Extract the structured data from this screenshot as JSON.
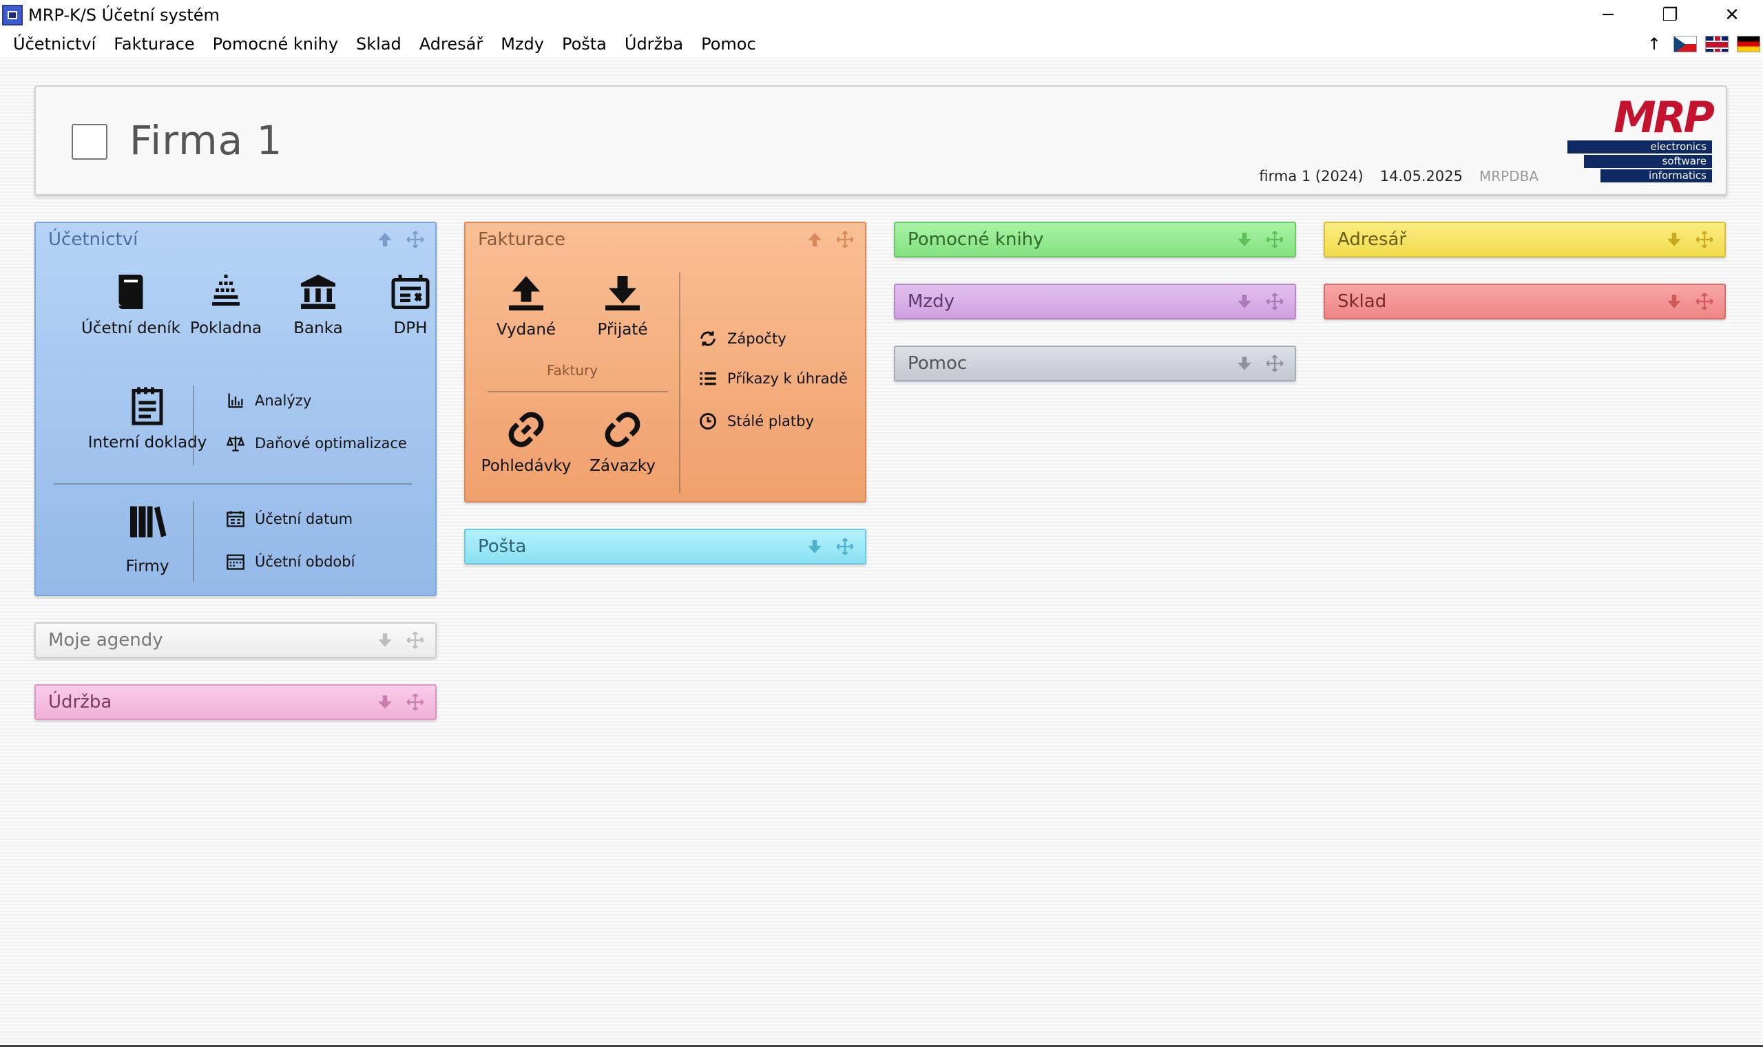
{
  "window": {
    "title": "MRP-K/S Účetní systém",
    "minimize": "─",
    "restore": "❐",
    "close": "✕"
  },
  "menu": {
    "items": [
      "Účetnictví",
      "Fakturace",
      "Pomocné knihy",
      "Sklad",
      "Adresář",
      "Mzdy",
      "Pošta",
      "Údržba",
      "Pomoc"
    ],
    "arrow": "↑",
    "languages": [
      "cz-flag-icon",
      "gb-flag-icon",
      "de-flag-icon"
    ]
  },
  "header": {
    "company": "Firma 1",
    "firm_year": "firma 1 (2024)",
    "date": "14.05.2025",
    "user": "MRPDBA",
    "logo": {
      "text": "MRP",
      "lines": [
        "electronics",
        "software",
        "informatics"
      ]
    }
  },
  "tiles": {
    "ucetnictvi": {
      "title": "Účetnictví",
      "items": [
        "Účetní deník",
        "Pokladna",
        "Banka",
        "DPH",
        "Interní doklady",
        "Firmy"
      ],
      "links": [
        "Analýzy",
        "Daňové optimalizace",
        "Účetní datum",
        "Účetní období"
      ]
    },
    "fakturace": {
      "title": "Fakturace",
      "items": [
        "Vydané",
        "Přijaté",
        "Pohledávky",
        "Závazky"
      ],
      "group_label": "Faktury",
      "links": [
        "Zápočty",
        "Příkazy k úhradě",
        "Stálé platby"
      ]
    },
    "pomocne_knihy": {
      "title": "Pomocné knihy"
    },
    "adresar": {
      "title": "Adresář"
    },
    "mzdy": {
      "title": "Mzdy"
    },
    "sklad": {
      "title": "Sklad"
    },
    "pomoc": {
      "title": "Pomoc"
    },
    "posta": {
      "title": "Pošta"
    },
    "moje_agendy": {
      "title": "Moje agendy"
    },
    "udrzba": {
      "title": "Údržba"
    }
  },
  "colors": {
    "ucetnictvi": "#a9c8f0",
    "fakturace": "#f5b07f",
    "pomocne_knihy": "#96ec92",
    "adresar": "#f6e566",
    "mzdy": "#d9b0e6",
    "sklad": "#f39595",
    "pomoc": "#d0d4da",
    "posta": "#9fe9f7",
    "moje_agendy": "#f4f4f4",
    "udrzba": "#f5bfe0",
    "logo_red": "#c4122f",
    "logo_blue": "#0f2a63"
  }
}
